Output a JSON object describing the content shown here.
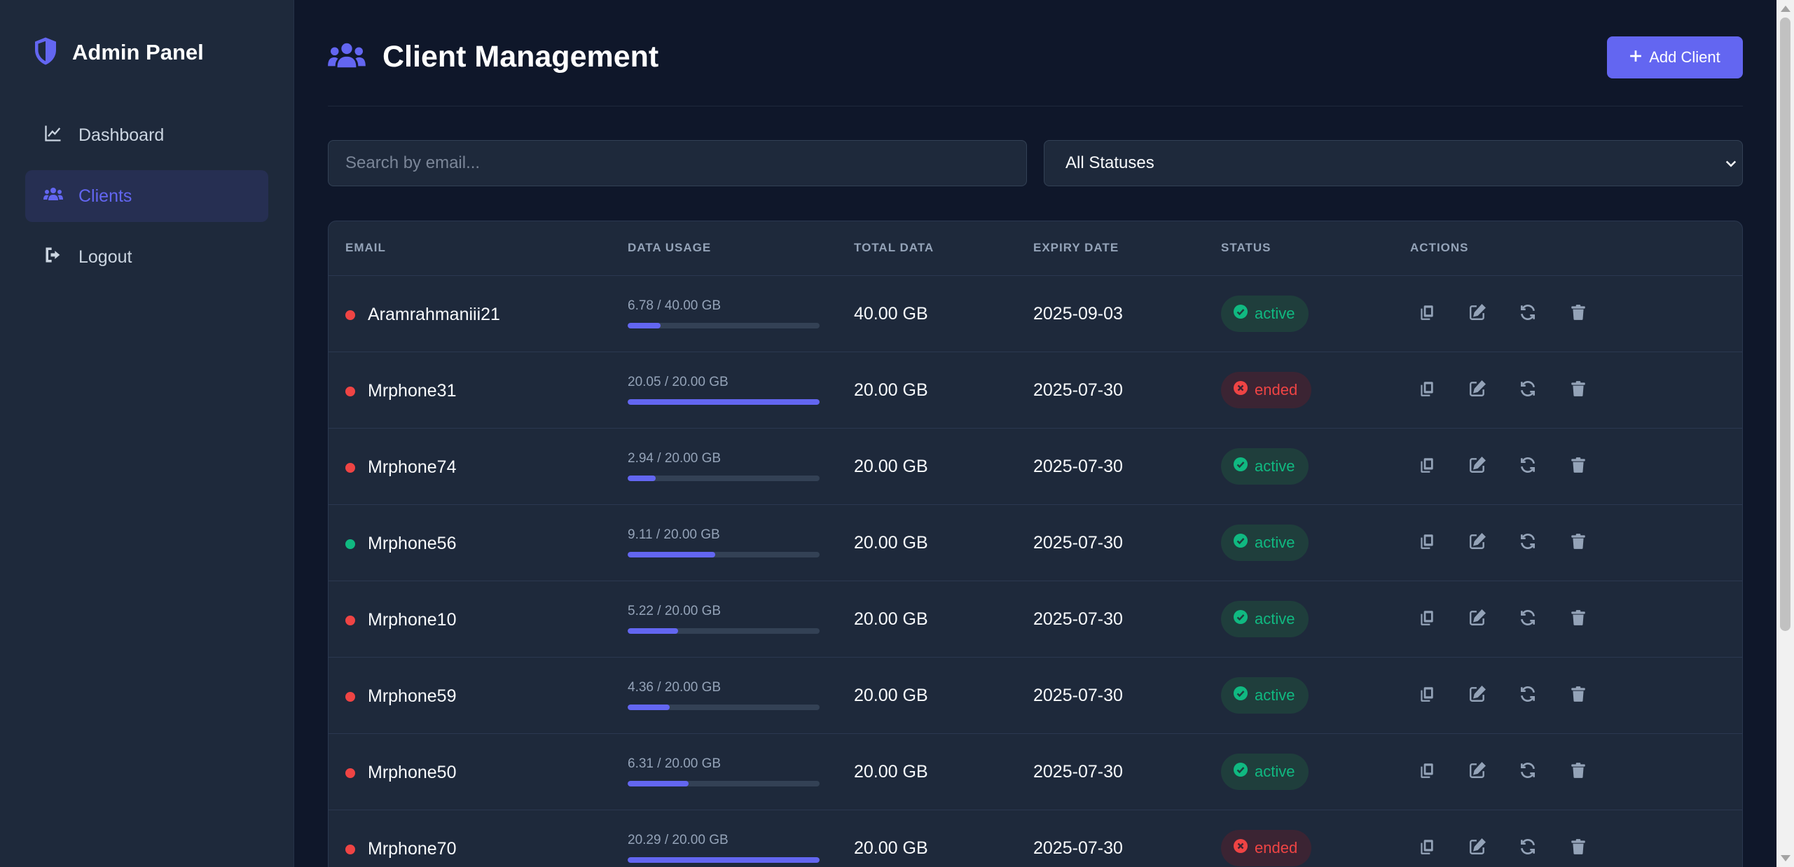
{
  "sidebar": {
    "brand": "Admin Panel",
    "items": [
      {
        "label": "Dashboard",
        "icon": "chart-line-icon",
        "active": false
      },
      {
        "label": "Clients",
        "icon": "users-icon",
        "active": true
      },
      {
        "label": "Logout",
        "icon": "logout-icon",
        "active": false
      }
    ]
  },
  "header": {
    "title": "Client Management",
    "add_label": "Add Client"
  },
  "filters": {
    "search_placeholder": "Search by email...",
    "status_selected": "All Statuses"
  },
  "table": {
    "columns": [
      "EMAIL",
      "DATA USAGE",
      "TOTAL DATA",
      "EXPIRY DATE",
      "STATUS",
      "ACTIONS"
    ],
    "rows": [
      {
        "email": "Aramrahmaniii21",
        "online": false,
        "usage": "6.78 / 40.00 GB",
        "usage_pct": 17,
        "total": "40.00 GB",
        "expiry": "2025-09-03",
        "status": "active"
      },
      {
        "email": "Mrphone31",
        "online": false,
        "usage": "20.05 / 20.00 GB",
        "usage_pct": 100,
        "total": "20.00 GB",
        "expiry": "2025-07-30",
        "status": "ended"
      },
      {
        "email": "Mrphone74",
        "online": false,
        "usage": "2.94 / 20.00 GB",
        "usage_pct": 14.7,
        "total": "20.00 GB",
        "expiry": "2025-07-30",
        "status": "active"
      },
      {
        "email": "Mrphone56",
        "online": true,
        "usage": "9.11 / 20.00 GB",
        "usage_pct": 45.6,
        "total": "20.00 GB",
        "expiry": "2025-07-30",
        "status": "active"
      },
      {
        "email": "Mrphone10",
        "online": false,
        "usage": "5.22 / 20.00 GB",
        "usage_pct": 26.1,
        "total": "20.00 GB",
        "expiry": "2025-07-30",
        "status": "active"
      },
      {
        "email": "Mrphone59",
        "online": false,
        "usage": "4.36 / 20.00 GB",
        "usage_pct": 21.8,
        "total": "20.00 GB",
        "expiry": "2025-07-30",
        "status": "active"
      },
      {
        "email": "Mrphone50",
        "online": false,
        "usage": "6.31 / 20.00 GB",
        "usage_pct": 31.6,
        "total": "20.00 GB",
        "expiry": "2025-07-30",
        "status": "active"
      },
      {
        "email": "Mrphone70",
        "online": false,
        "usage": "20.29 / 20.00 GB",
        "usage_pct": 100,
        "total": "20.00 GB",
        "expiry": "2025-07-30",
        "status": "ended"
      }
    ]
  },
  "colors": {
    "accent": "#6366f1",
    "active": "#10b981",
    "ended": "#ef4444",
    "dot_online": "#10b981",
    "dot_offline": "#ef4444"
  },
  "action_icons": [
    "copy-icon",
    "edit-icon",
    "refresh-icon",
    "trash-icon"
  ]
}
